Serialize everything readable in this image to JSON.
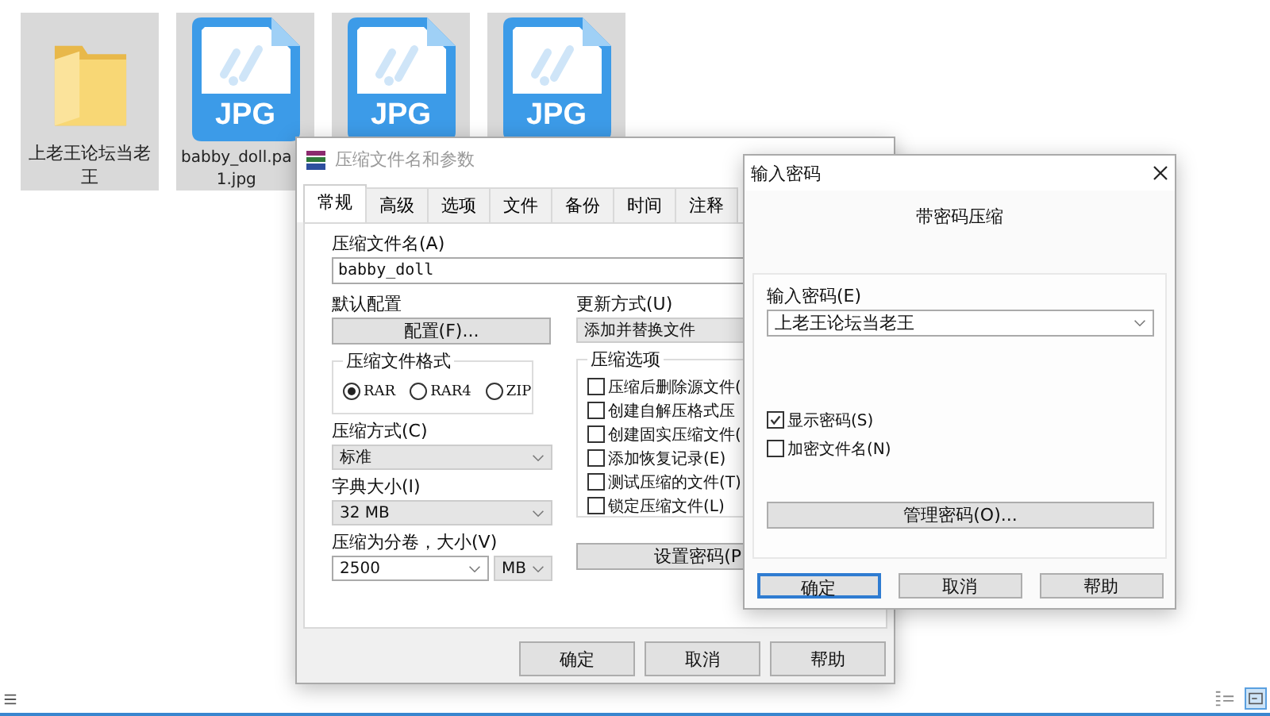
{
  "desktop_icons": [
    {
      "kind": "folder",
      "selected": true,
      "label": "上老王论坛当老王"
    },
    {
      "kind": "jpg",
      "selected": true,
      "badge": "JPG",
      "label_lines": [
        "babby_doll.pa",
        "1.jpg"
      ]
    },
    {
      "kind": "jpg",
      "selected": true,
      "badge": "JPG"
    },
    {
      "kind": "jpg",
      "selected": true,
      "badge": "JPG"
    }
  ],
  "archive_dialog": {
    "title": "压缩文件名和参数",
    "tabs": [
      {
        "label": "常规",
        "selected": true
      },
      {
        "label": "高级",
        "selected": false
      },
      {
        "label": "选项",
        "selected": false
      },
      {
        "label": "文件",
        "selected": false
      },
      {
        "label": "备份",
        "selected": false
      },
      {
        "label": "时间",
        "selected": false
      },
      {
        "label": "注释",
        "selected": false
      }
    ],
    "archive_name_label": "压缩文件名(A)",
    "archive_name_value": "babby_doll",
    "profile_label": "默认配置",
    "profile_button": "配置(F)...",
    "update_mode_label": "更新方式(U)",
    "update_mode_value": "添加并替换文件",
    "format_group": {
      "title": "压缩文件格式",
      "options": [
        {
          "label": "RAR",
          "selected": true
        },
        {
          "label": "RAR4",
          "selected": false
        },
        {
          "label": "ZIP",
          "selected": false
        }
      ]
    },
    "options_group": {
      "title": "压缩选项",
      "options": [
        {
          "label": "压缩后删除源文件(",
          "checked": false
        },
        {
          "label": "创建自解压格式压",
          "checked": false
        },
        {
          "label": "创建固实压缩文件(",
          "checked": false
        },
        {
          "label": "添加恢复记录(E)",
          "checked": false
        },
        {
          "label": "测试压缩的文件(T)",
          "checked": false
        },
        {
          "label": "锁定压缩文件(L)",
          "checked": false
        }
      ]
    },
    "method_label": "压缩方式(C)",
    "method_value": "标准",
    "dictionary_label": "字典大小(I)",
    "dictionary_value": "32 MB",
    "volume_label": "压缩为分卷，大小(V)",
    "volume_value": "2500",
    "volume_unit": "MB",
    "password_button": "设置密码(P",
    "buttons": [
      "确定",
      "取消",
      "帮助"
    ]
  },
  "password_dialog": {
    "title": "输入密码",
    "heading": "带密码压缩",
    "password_label": "输入密码(E)",
    "password_value": "上老王论坛当老王",
    "checkboxes": [
      {
        "label": "显示密码(S)",
        "checked": true
      },
      {
        "label": "加密文件名(N)",
        "checked": false
      }
    ],
    "manage_button": "管理密码(O)...",
    "buttons": [
      {
        "label": "确定",
        "focused": true
      },
      {
        "label": "取消",
        "focused": false
      },
      {
        "label": "帮助",
        "focused": false
      }
    ]
  }
}
